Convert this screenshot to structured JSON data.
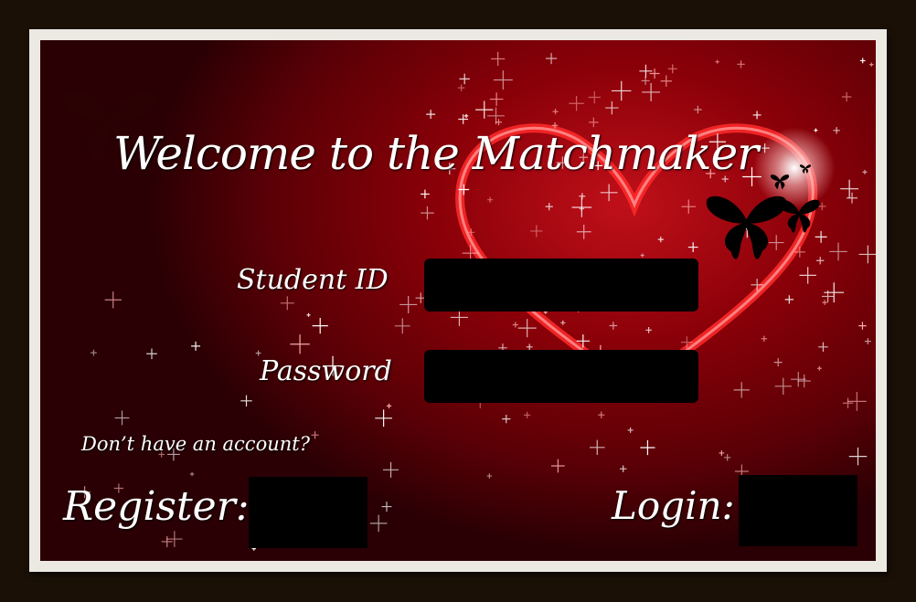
{
  "title": "Welcome to the Matchmaker",
  "form": {
    "student_id_label": "Student ID",
    "student_id_value": "",
    "password_label": "Password",
    "password_value": ""
  },
  "register": {
    "prompt": "Don’t have an account?",
    "label": "Register:"
  },
  "login": {
    "label": "Login:"
  },
  "colors": {
    "frame": "#1a1006",
    "mat": "#ece8e2",
    "background": "#8a0008",
    "input": "#000000",
    "text": "#ffffff"
  }
}
